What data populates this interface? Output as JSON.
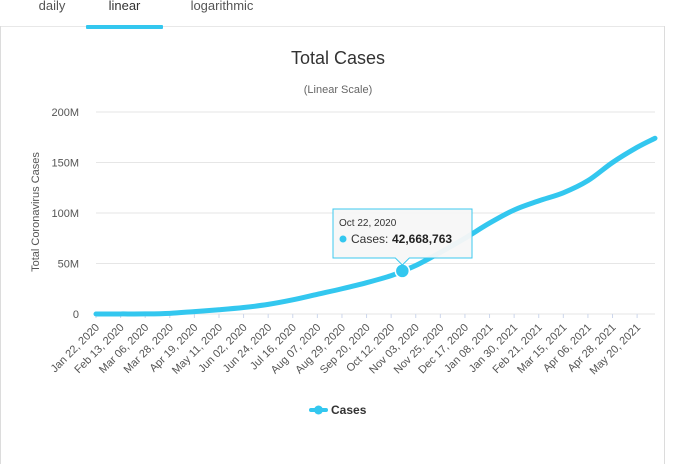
{
  "tabs": [
    {
      "label": "daily"
    },
    {
      "label": "linear"
    },
    {
      "label": "logarithmic"
    }
  ],
  "active_tab": "linear",
  "colors": {
    "accent": "#33c7ef",
    "series": "#33c7ef",
    "grid": "#e6e6e6"
  },
  "chart_data": {
    "type": "line",
    "title": "Total Cases",
    "subtitle": "(Linear Scale)",
    "ylabel": "Total Coronavirus Cases",
    "xlabel": "",
    "ylim": [
      0,
      200000000
    ],
    "y_ticks": [
      "0",
      "50M",
      "100M",
      "150M",
      "200M"
    ],
    "y_tick_values": [
      0,
      50000000,
      100000000,
      150000000,
      200000000
    ],
    "x_ticks": [
      "Jan 22, 2020",
      "Feb 13, 2020",
      "Mar 06, 2020",
      "Mar 28, 2020",
      "Apr 19, 2020",
      "May 11, 2020",
      "Jun 02, 2020",
      "Jun 24, 2020",
      "Jul 16, 2020",
      "Aug 07, 2020",
      "Aug 29, 2020",
      "Sep 20, 2020",
      "Oct 12, 2020",
      "Nov 03, 2020",
      "Nov 25, 2020",
      "Dec 17, 2020",
      "Jan 08, 2021",
      "Jan 30, 2021",
      "Feb 21, 2021",
      "Mar 15, 2021",
      "Apr 06, 2021",
      "Apr 28, 2021",
      "May 20, 2021"
    ],
    "grid": true,
    "legend": "bottom-center",
    "series": [
      {
        "name": "Cases",
        "x": [
          "Jan 22, 2020",
          "Feb 13, 2020",
          "Mar 06, 2020",
          "Mar 28, 2020",
          "Apr 19, 2020",
          "May 11, 2020",
          "Jun 02, 2020",
          "Jun 24, 2020",
          "Jul 16, 2020",
          "Aug 07, 2020",
          "Aug 29, 2020",
          "Sep 20, 2020",
          "Oct 12, 2020",
          "Oct 22, 2020",
          "Nov 03, 2020",
          "Nov 25, 2020",
          "Dec 17, 2020",
          "Jan 08, 2021",
          "Jan 30, 2021",
          "Feb 21, 2021",
          "Mar 15, 2021",
          "Apr 06, 2021",
          "Apr 28, 2021",
          "May 20, 2021",
          "Jun 05, 2021"
        ],
        "values": [
          600,
          60000,
          100000,
          660000,
          2400000,
          4200000,
          6400000,
          9500000,
          14000000,
          19500000,
          25000000,
          31000000,
          38000000,
          42668763,
          48000000,
          61000000,
          75000000,
          90000000,
          103000000,
          112000000,
          120000000,
          132000000,
          150000000,
          165000000,
          174000000
        ]
      }
    ],
    "tooltip": {
      "date": "Oct 22, 2020",
      "label": "Cases: ",
      "value": "42,668,763",
      "x": "Oct 22, 2020"
    }
  }
}
